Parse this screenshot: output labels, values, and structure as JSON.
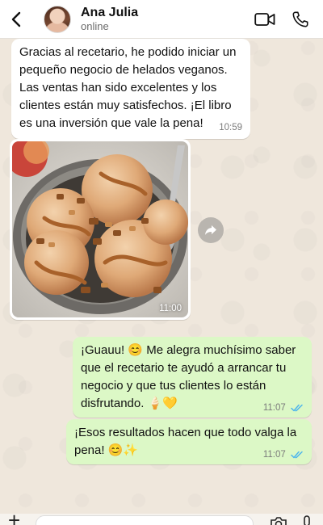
{
  "header": {
    "contact_name": "Ana Julia",
    "status": "online",
    "icons": [
      "back-arrow-icon",
      "video-call-icon",
      "phone-icon"
    ]
  },
  "messages": [
    {
      "direction": "incoming",
      "text": "Gracias al recetario, he podido iniciar un pequeño negocio de helados veganos. Las ventas han sido excelentes y los clientes están muy satisfechos. ¡El libro es una inversión que vale la pena!",
      "time": "10:59"
    },
    {
      "direction": "incoming",
      "type": "image",
      "image_subject": "bowl of caramel ice cream with nuts",
      "time": "11:00"
    },
    {
      "direction": "outgoing",
      "text": "¡Guauu! 😊 Me alegra muchísimo saber que el recetario te ayudó a arrancar tu negocio y que tus clientes lo están disfrutando. 🍦💛",
      "time": "11:07",
      "read": true
    },
    {
      "direction": "outgoing",
      "text": "¡Esos resultados hacen que todo valga la pena! 😊✨",
      "time": "11:07",
      "read": true
    }
  ],
  "colors": {
    "incoming_bubble": "#ffffff",
    "outgoing_bubble": "#dcf8c6",
    "read_ticks": "#4fb6ec",
    "wallpaper": "#efe7dc"
  }
}
